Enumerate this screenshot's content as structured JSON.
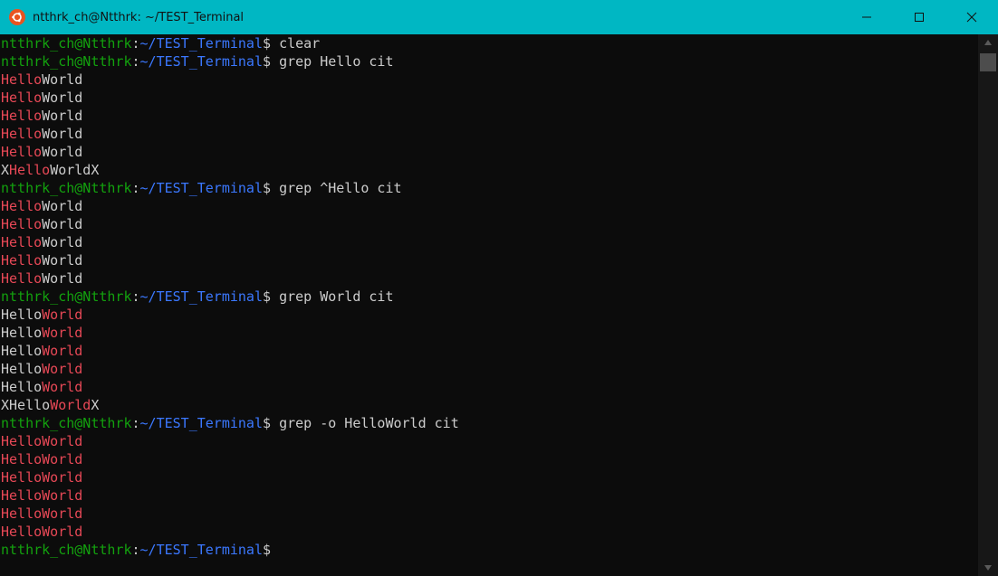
{
  "window": {
    "title": "ntthrk_ch@Ntthrk: ~/TEST_Terminal",
    "minimize_icon": "minimize-icon",
    "maximize_icon": "maximize-icon",
    "close_icon": "close-icon"
  },
  "colors": {
    "titlebar": "#00b7c3",
    "background": "#0c0c0c",
    "user": "#13a10e",
    "path": "#3b78ff",
    "match": "#e74856",
    "text": "#cccccc"
  },
  "terminal": {
    "lines": [
      {
        "type": "prompt",
        "user": "ntthrk_ch@Ntthrk",
        "sep": ":",
        "path": "~/TEST_Terminal",
        "symbol": "$ ",
        "cmd": "clear"
      },
      {
        "type": "prompt",
        "user": "ntthrk_ch@Ntthrk",
        "sep": ":",
        "path": "~/TEST_Terminal",
        "symbol": "$ ",
        "cmd": "grep Hello cit"
      },
      {
        "type": "out",
        "segs": [
          {
            "t": "Hello",
            "c": "red"
          },
          {
            "t": "World",
            "c": "white"
          }
        ]
      },
      {
        "type": "out",
        "segs": [
          {
            "t": "Hello",
            "c": "red"
          },
          {
            "t": "World",
            "c": "white"
          }
        ]
      },
      {
        "type": "out",
        "segs": [
          {
            "t": "Hello",
            "c": "red"
          },
          {
            "t": "World",
            "c": "white"
          }
        ]
      },
      {
        "type": "out",
        "segs": [
          {
            "t": "Hello",
            "c": "red"
          },
          {
            "t": "World",
            "c": "white"
          }
        ]
      },
      {
        "type": "out",
        "segs": [
          {
            "t": "Hello",
            "c": "red"
          },
          {
            "t": "World",
            "c": "white"
          }
        ]
      },
      {
        "type": "out",
        "segs": [
          {
            "t": "X",
            "c": "white"
          },
          {
            "t": "Hello",
            "c": "red"
          },
          {
            "t": "WorldX",
            "c": "white"
          }
        ]
      },
      {
        "type": "prompt",
        "user": "ntthrk_ch@Ntthrk",
        "sep": ":",
        "path": "~/TEST_Terminal",
        "symbol": "$ ",
        "cmd": "grep ^Hello cit"
      },
      {
        "type": "out",
        "segs": [
          {
            "t": "Hello",
            "c": "red"
          },
          {
            "t": "World",
            "c": "white"
          }
        ]
      },
      {
        "type": "out",
        "segs": [
          {
            "t": "Hello",
            "c": "red"
          },
          {
            "t": "World",
            "c": "white"
          }
        ]
      },
      {
        "type": "out",
        "segs": [
          {
            "t": "Hello",
            "c": "red"
          },
          {
            "t": "World",
            "c": "white"
          }
        ]
      },
      {
        "type": "out",
        "segs": [
          {
            "t": "Hello",
            "c": "red"
          },
          {
            "t": "World",
            "c": "white"
          }
        ]
      },
      {
        "type": "out",
        "segs": [
          {
            "t": "Hello",
            "c": "red"
          },
          {
            "t": "World",
            "c": "white"
          }
        ]
      },
      {
        "type": "prompt",
        "user": "ntthrk_ch@Ntthrk",
        "sep": ":",
        "path": "~/TEST_Terminal",
        "symbol": "$ ",
        "cmd": "grep World cit"
      },
      {
        "type": "out",
        "segs": [
          {
            "t": "Hello",
            "c": "white"
          },
          {
            "t": "World",
            "c": "red"
          }
        ]
      },
      {
        "type": "out",
        "segs": [
          {
            "t": "Hello",
            "c": "white"
          },
          {
            "t": "World",
            "c": "red"
          }
        ]
      },
      {
        "type": "out",
        "segs": [
          {
            "t": "Hello",
            "c": "white"
          },
          {
            "t": "World",
            "c": "red"
          }
        ]
      },
      {
        "type": "out",
        "segs": [
          {
            "t": "Hello",
            "c": "white"
          },
          {
            "t": "World",
            "c": "red"
          }
        ]
      },
      {
        "type": "out",
        "segs": [
          {
            "t": "Hello",
            "c": "white"
          },
          {
            "t": "World",
            "c": "red"
          }
        ]
      },
      {
        "type": "out",
        "segs": [
          {
            "t": "XHello",
            "c": "white"
          },
          {
            "t": "World",
            "c": "red"
          },
          {
            "t": "X",
            "c": "white"
          }
        ]
      },
      {
        "type": "prompt",
        "user": "ntthrk_ch@Ntthrk",
        "sep": ":",
        "path": "~/TEST_Terminal",
        "symbol": "$ ",
        "cmd": "grep -o HelloWorld cit"
      },
      {
        "type": "out",
        "segs": [
          {
            "t": "HelloWorld",
            "c": "red"
          }
        ]
      },
      {
        "type": "out",
        "segs": [
          {
            "t": "HelloWorld",
            "c": "red"
          }
        ]
      },
      {
        "type": "out",
        "segs": [
          {
            "t": "HelloWorld",
            "c": "red"
          }
        ]
      },
      {
        "type": "out",
        "segs": [
          {
            "t": "HelloWorld",
            "c": "red"
          }
        ]
      },
      {
        "type": "out",
        "segs": [
          {
            "t": "HelloWorld",
            "c": "red"
          }
        ]
      },
      {
        "type": "out",
        "segs": [
          {
            "t": "HelloWorld",
            "c": "red"
          }
        ]
      },
      {
        "type": "prompt",
        "user": "ntthrk_ch@Ntthrk",
        "sep": ":",
        "path": "~/TEST_Terminal",
        "symbol": "$",
        "cmd": ""
      }
    ]
  }
}
